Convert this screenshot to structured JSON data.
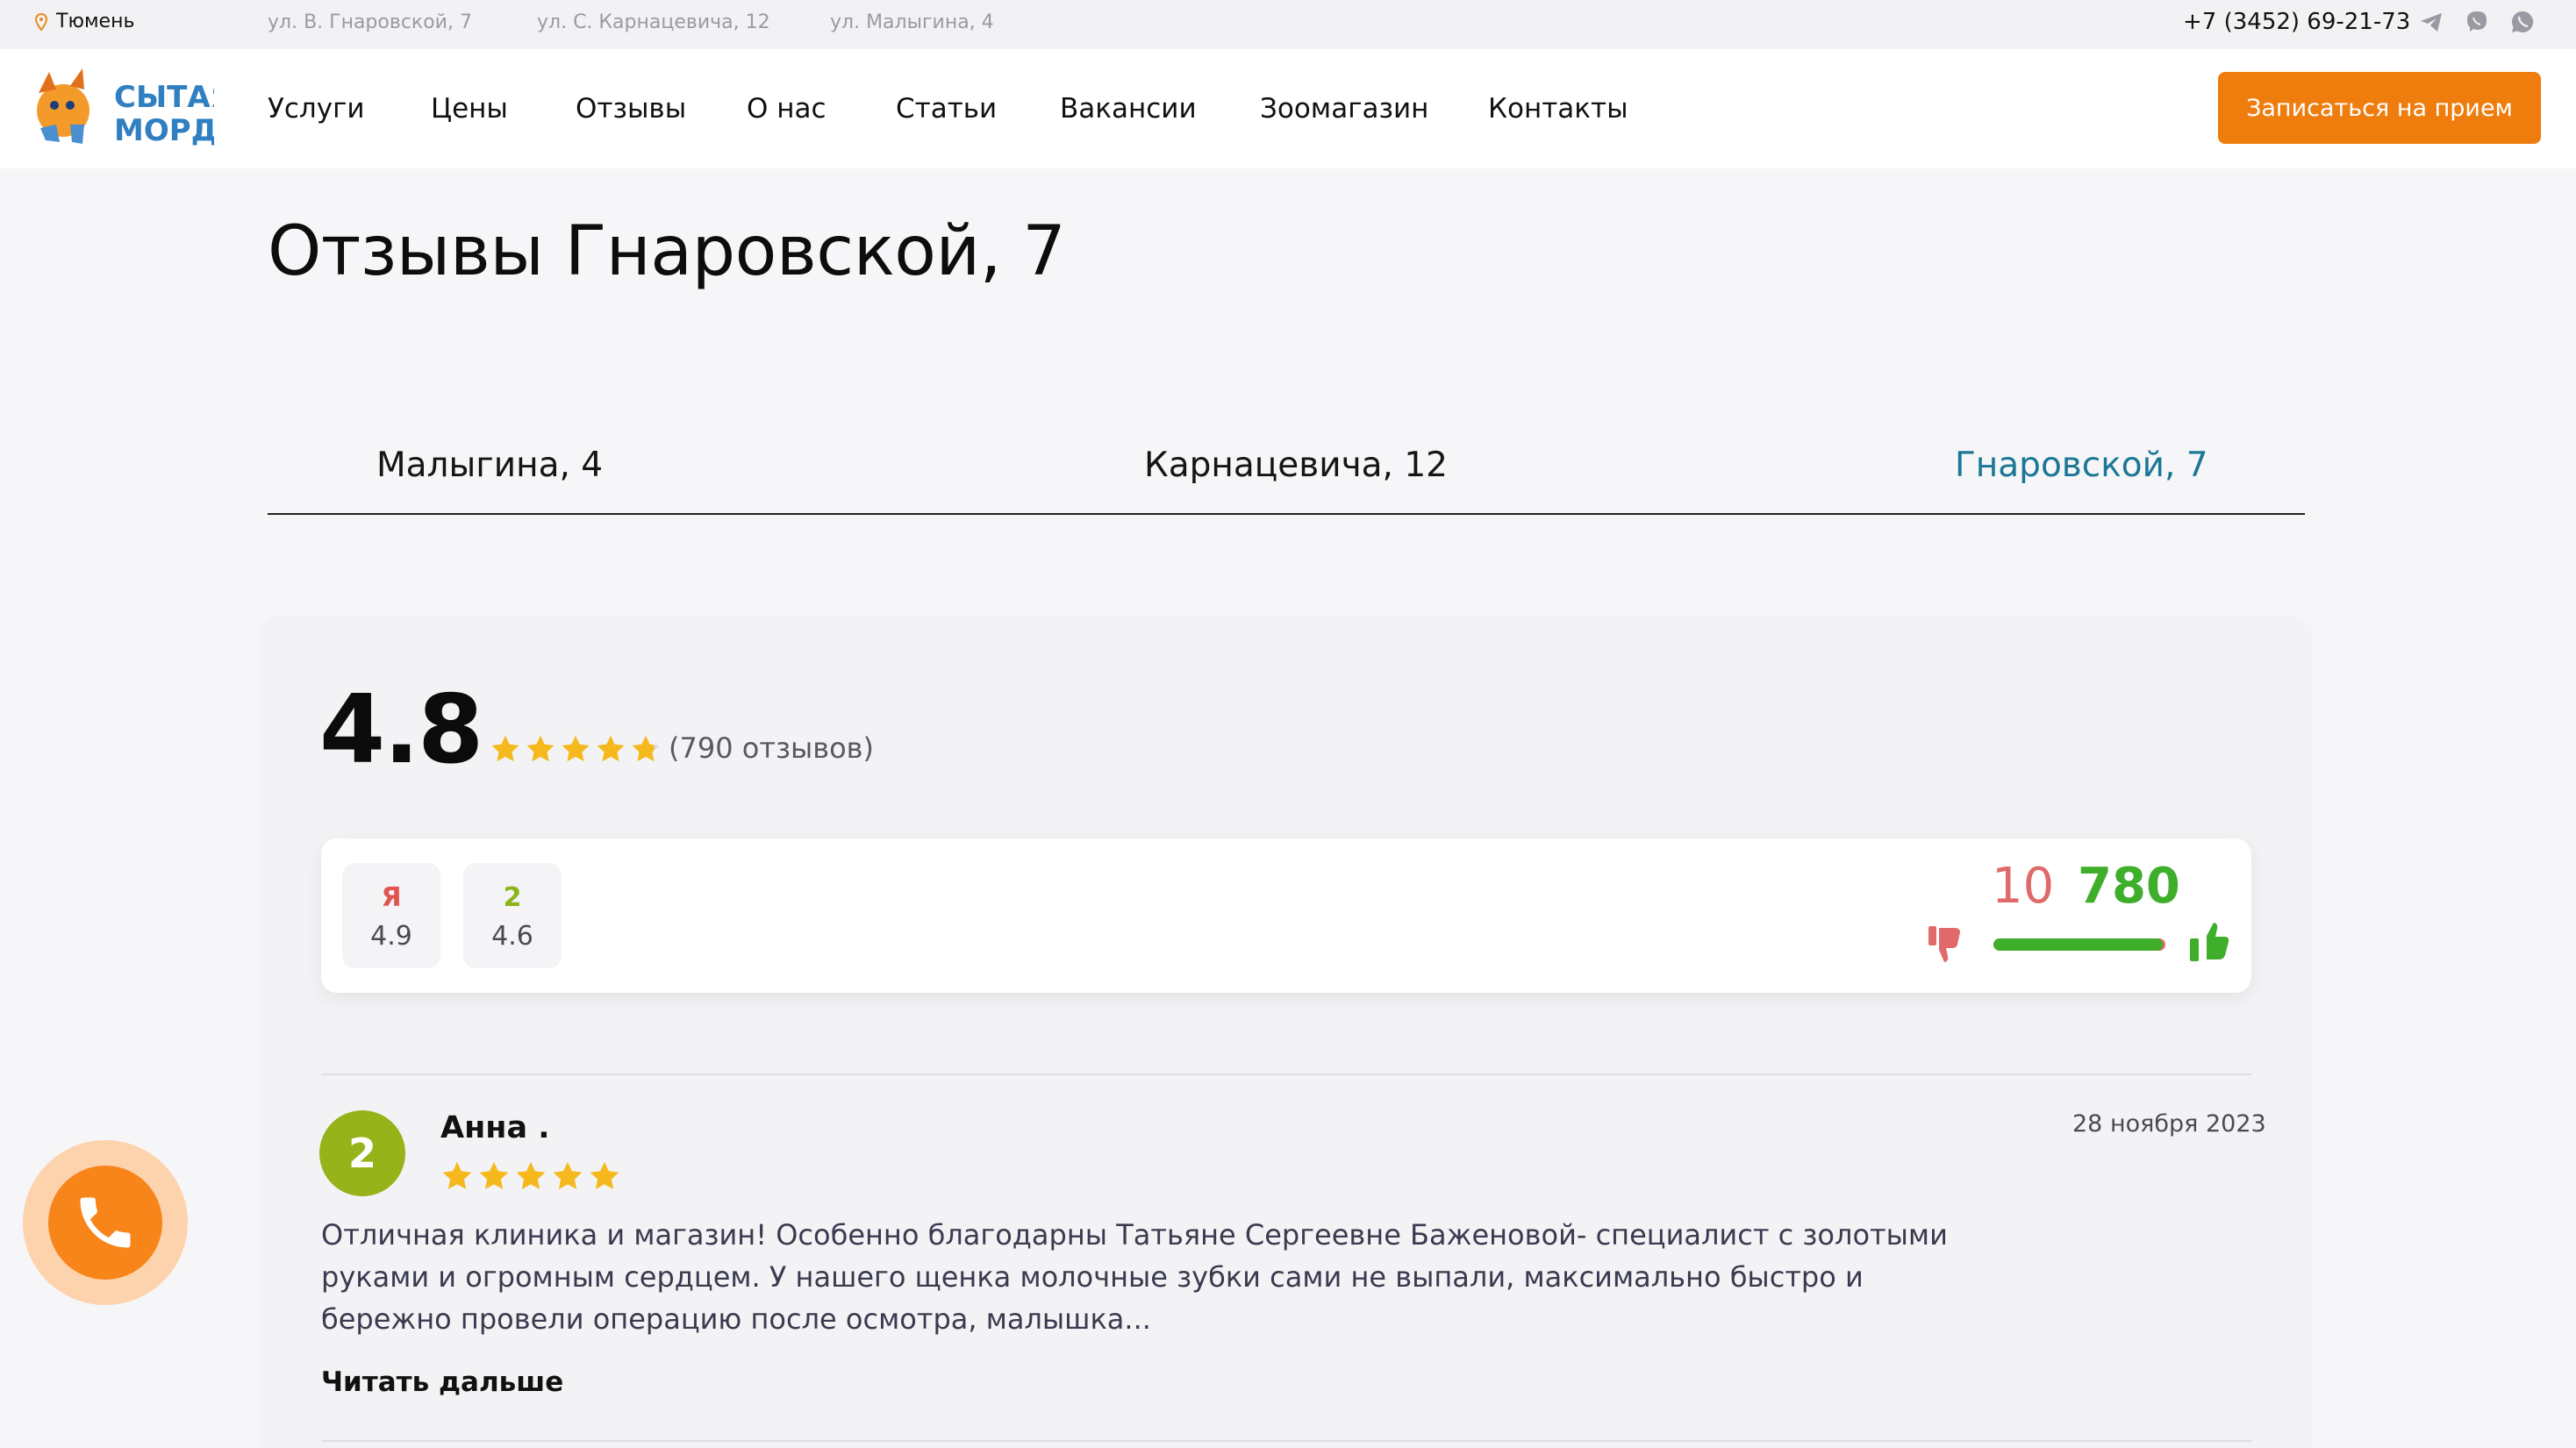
{
  "topbar": {
    "city": "Тюмень",
    "addresses": [
      "ул. В. Гнаровской, 7",
      "ул. С. Карнацевича, 12",
      "ул. Малыгина, 4"
    ],
    "phone": "+7 (3452) 69-21-73",
    "icons": [
      "map-pin-icon",
      "telegram-icon",
      "viber-icon",
      "whatsapp-icon"
    ]
  },
  "header": {
    "logo_text": [
      "СЫТАЯ",
      "МОРДА"
    ],
    "nav": [
      "Услуги",
      "Цены",
      "Отзывы",
      "О нас",
      "Статьи",
      "Вакансии",
      "Зоомагазин",
      "Контакты"
    ],
    "cta": "Записаться на прием"
  },
  "page": {
    "title": "Отзывы Гнаровской, 7"
  },
  "tabs": [
    {
      "label": "Малыгина, 4",
      "active": false
    },
    {
      "label": "Карнацевича, 12",
      "active": false
    },
    {
      "label": "Гнаровской, 7",
      "active": true
    }
  ],
  "summary": {
    "rating": "4.8",
    "stars": 4.8,
    "count_text": "(790 отзывов)",
    "sources": [
      {
        "mark": "Я",
        "rating": "4.9",
        "color": "#e0534f"
      },
      {
        "mark": "2",
        "rating": "4.6",
        "color": "#8ab51a"
      }
    ],
    "negative": "10",
    "positive": "780",
    "positive_share": 0.987
  },
  "reviews": [
    {
      "avatar": "2",
      "author": "Анна .",
      "stars": 5,
      "date": "28 ноября 2023",
      "text": "Отличная клиника и магазин! Особенно благодарны Татьяне Сергеевне Баженовой- специалист с золотыми руками и огромным сердцем. У нашего щенка молочные зубки сами не выпали, максимально быстро и бережно провели операцию после осмотра, малышка...",
      "read_more": "Читать дальше"
    }
  ],
  "colors": {
    "accent_orange": "#ee7d0e",
    "active_tab": "#1b7796",
    "star": "#f5b91e",
    "negative": "#e06a6a",
    "positive": "#3fae2a"
  }
}
